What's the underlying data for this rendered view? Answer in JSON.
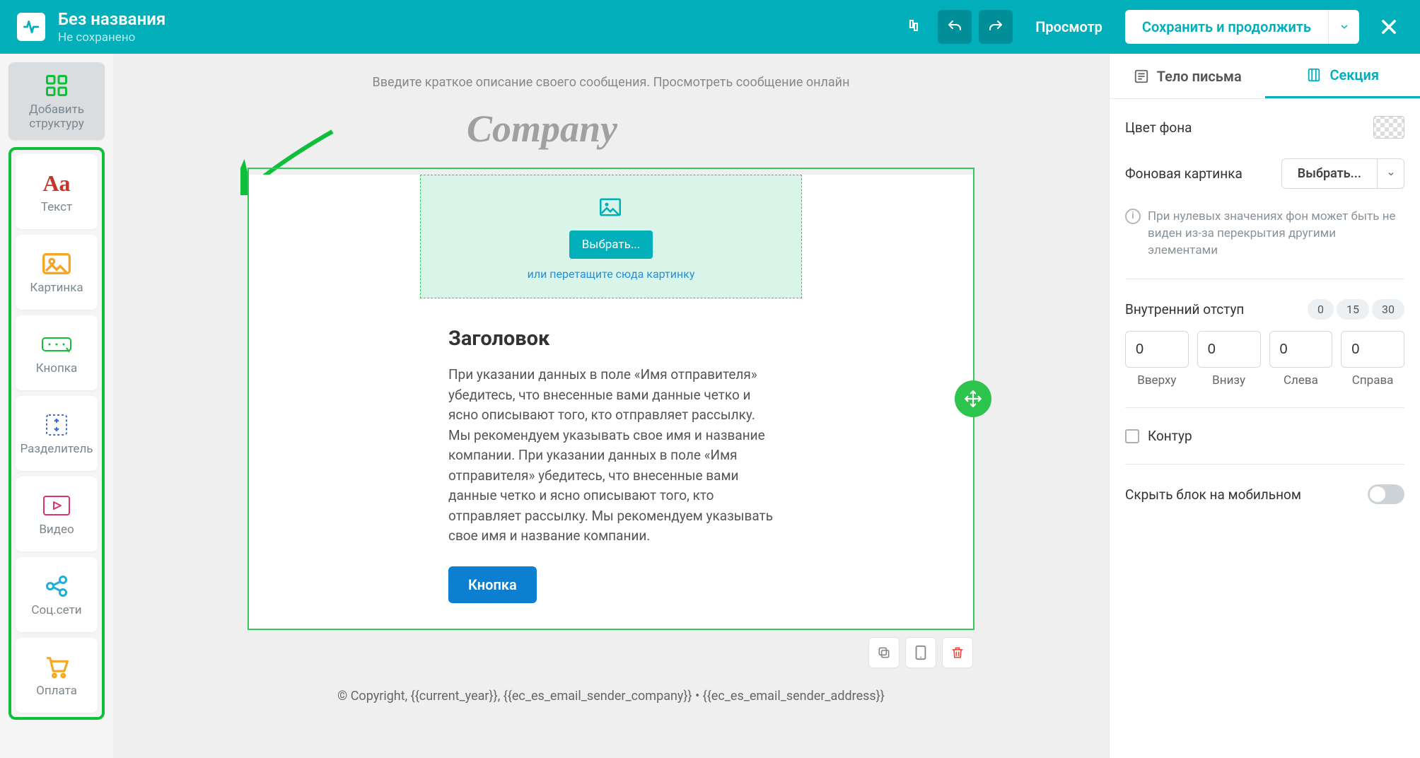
{
  "header": {
    "title": "Без названия",
    "subtitle": "Не сохранено",
    "preview_label": "Просмотр",
    "save_label": "Сохранить и продолжить"
  },
  "sidebar": {
    "structure_label": "Добавить структуру",
    "items": [
      {
        "label": "Текст"
      },
      {
        "label": "Картинка"
      },
      {
        "label": "Кнопка"
      },
      {
        "label": "Разделитель"
      },
      {
        "label": "Видео"
      },
      {
        "label": "Соц.сети"
      },
      {
        "label": "Оплата"
      }
    ]
  },
  "canvas": {
    "description": "Введите краткое описание своего сообщения. Просмотреть сообщение онлайн",
    "brand": "Company",
    "image_drop": {
      "select_label": "Выбрать...",
      "drag_label": "или перетащите сюда картинку"
    },
    "content": {
      "heading": "Заголовок",
      "body": "При указании данных в поле «Имя отправителя» убедитесь, что внесенные вами данные четко и ясно описывают того, кто отправляет рассылку. Мы рекомендуем указывать свое имя и название компании. При указании данных в поле «Имя отправителя» убедитесь, что внесенные вами данные четко и ясно описывают того, кто отправляет рассылку. Мы рекомендуем указывать свое имя и название компании.",
      "cta_label": "Кнопка"
    },
    "footer": "© Copyright, {{current_year}}, {{ec_es_email_sender_company}} • {{ec_es_email_sender_address}}"
  },
  "panel": {
    "tabs": {
      "body": "Тело письма",
      "section": "Секция"
    },
    "bg_color_label": "Цвет фона",
    "bg_image_label": "Фоновая картинка",
    "bg_image_select": "Выбрать...",
    "info_text": "При нулевых значениях фон может быть не виден из-за перекрытия другими элементами",
    "padding": {
      "label": "Внутренний отступ",
      "presets": [
        "0",
        "15",
        "30"
      ],
      "values": {
        "top": "0",
        "bottom": "0",
        "left": "0",
        "right": "0"
      },
      "labels": {
        "top": "Вверху",
        "bottom": "Внизу",
        "left": "Слева",
        "right": "Справа"
      }
    },
    "outline_label": "Контур",
    "hide_mobile_label": "Скрыть блок на мобильном"
  }
}
